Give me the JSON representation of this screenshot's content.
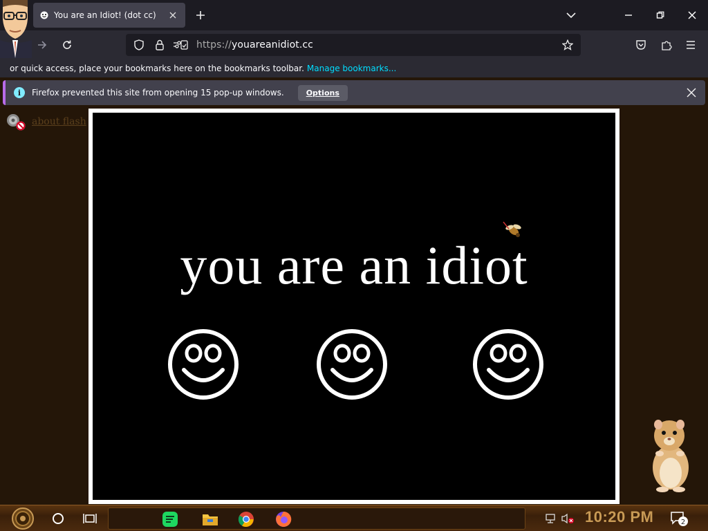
{
  "browser": {
    "tab": {
      "title": "You are an Idiot! (dot cc)"
    },
    "url": {
      "scheme": "https://",
      "host": "youareanidiot.cc"
    },
    "bookmarks_bar": {
      "text": "or quick access, place your bookmarks here on the bookmarks toolbar.",
      "manage_link": "Manage bookmarks..."
    },
    "notification": {
      "message": "Firefox prevented this site from opening 15 pop-up windows.",
      "options_label": "Options"
    }
  },
  "page": {
    "flash_link": "about flash",
    "headline": "you are an idiot",
    "smileys": [
      "smiley-face",
      "smiley-face",
      "smiley-face"
    ]
  },
  "taskbar": {
    "clock": "10:20 PM",
    "notification_count": "2"
  },
  "colors": {
    "accent_link": "#00ddff",
    "notification_stripe": "#b86be8",
    "page_background": "#241608",
    "stage_background": "#000000",
    "clock": "#c89a55"
  },
  "icons": [
    "smiley-favicon",
    "close-icon",
    "plus-icon",
    "chevron-down-icon",
    "minimize-icon",
    "maximize-icon",
    "back-icon",
    "forward-icon",
    "reload-icon",
    "shield-icon",
    "lock-icon",
    "permissions-icon",
    "star-icon",
    "pocket-icon",
    "extensions-icon",
    "menu-icon",
    "info-icon",
    "plugin-blocked-icon",
    "cortana-icon",
    "task-view-icon",
    "spotify-icon",
    "folder-icon",
    "chrome-icon",
    "firefox-icon",
    "network-icon",
    "volume-muted-icon",
    "notification-icon"
  ]
}
